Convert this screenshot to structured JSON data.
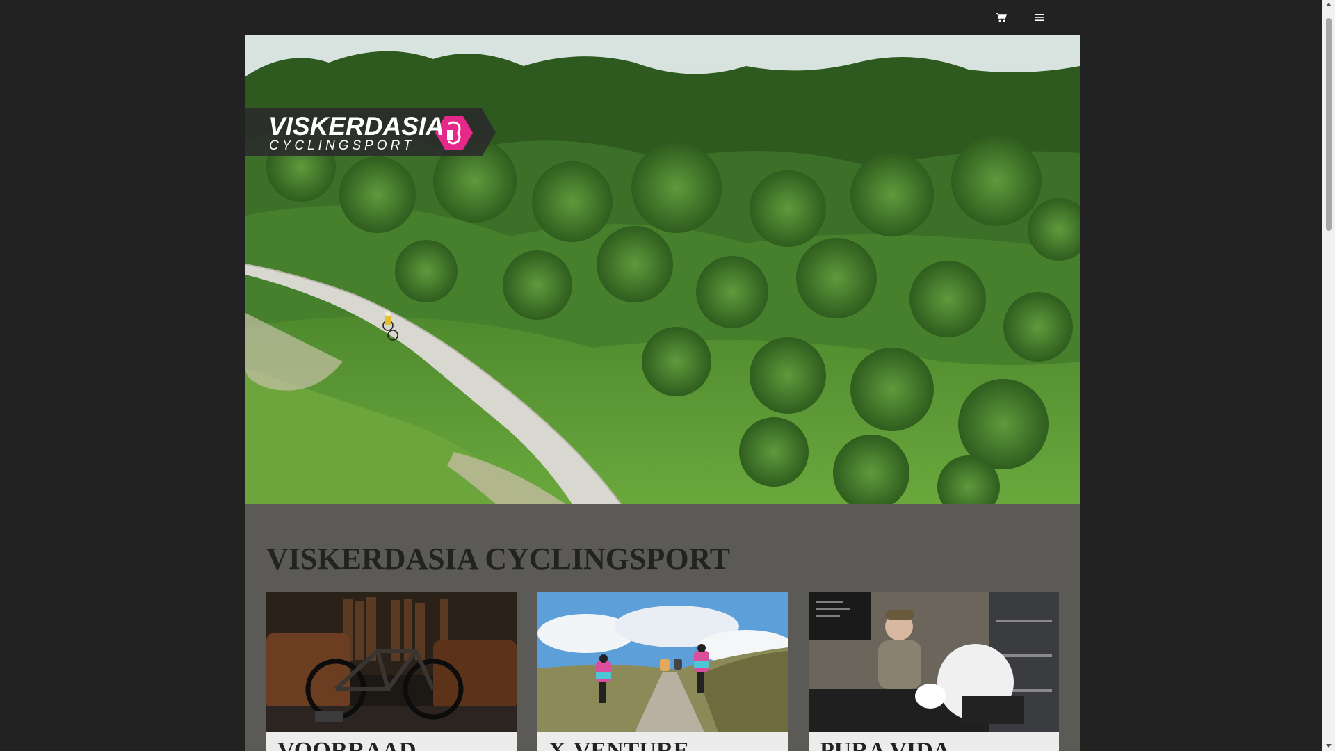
{
  "header": {
    "cart_icon": "cart-icon",
    "menu_icon": "hamburger-menu-icon"
  },
  "hero": {
    "logo": {
      "main": "VISKERDASIA",
      "sub": "CYCLINGSPORT",
      "accent_color": "#e6288a"
    }
  },
  "main": {
    "title": "VISKERDASIA CYCLINGSPORT",
    "cards": [
      {
        "title": "VOORRAAD"
      },
      {
        "title": "X-VENTURE"
      },
      {
        "title": "PURA VIDA"
      }
    ]
  },
  "colors": {
    "page_background": "#222222",
    "content_background": "#5b5a56",
    "card_background": "#ececec",
    "title_text": "#222222"
  }
}
